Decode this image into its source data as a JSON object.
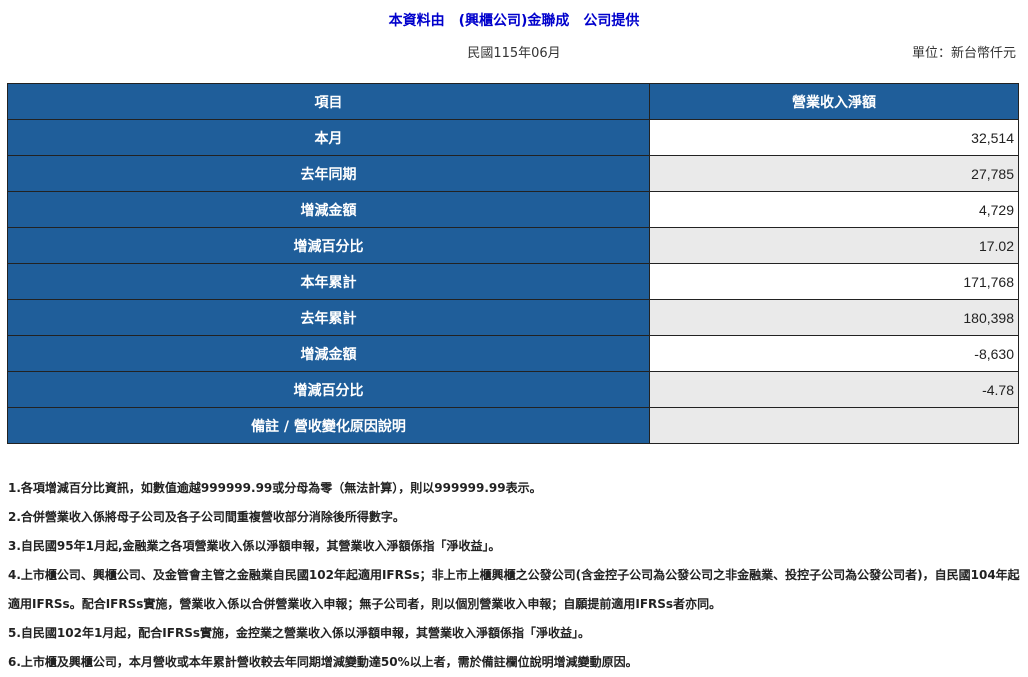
{
  "header": {
    "title": "本資料由　(興櫃公司)金聯成　公司提供",
    "period": "民國115年06月",
    "unit": "單位：新台幣仟元"
  },
  "table": {
    "columns": [
      "項目",
      "營業收入淨額"
    ],
    "rows": [
      {
        "label": "本月",
        "value": "32,514"
      },
      {
        "label": "去年同期",
        "value": "27,785"
      },
      {
        "label": "增減金額",
        "value": "4,729"
      },
      {
        "label": "增減百分比",
        "value": "17.02"
      },
      {
        "label": "本年累計",
        "value": "171,768"
      },
      {
        "label": "去年累計",
        "value": "180,398"
      },
      {
        "label": "增減金額",
        "value": "-8,630"
      },
      {
        "label": "增減百分比",
        "value": "-4.78"
      },
      {
        "label": "備註 / 營收變化原因說明",
        "value": ""
      }
    ]
  },
  "notes": [
    "1.各項增減百分比資訊，如數值逾越999999.99或分母為零（無法計算），則以999999.99表示。",
    "2.合併營業收入係將母子公司及各子公司間重複營收部分消除後所得數字。",
    "3.自民國95年1月起,金融業之各項營業收入係以淨額申報，其營業收入淨額係指「淨收益」。",
    "4.上市櫃公司、興櫃公司、及金管會主管之金融業自民國102年起適用IFRSs；非上市上櫃興櫃之公發公司(含金控子公司為公發公司之非金融業、投控子公司為公發公司者)，自民國104年起適用IFRSs。配合IFRSs實施，營業收入係以合併營業收入申報；無子公司者，則以個別營業收入申報；自願提前適用IFRSs者亦同。",
    "5.自民國102年1月起，配合IFRSs實施，金控業之營業收入係以淨額申報，其營業收入淨額係指「淨收益」。",
    "6.上市櫃及興櫃公司，本月營收或本年累計營收較去年同期增減變動達50%以上者，需於備註欄位說明增減變動原因。"
  ]
}
